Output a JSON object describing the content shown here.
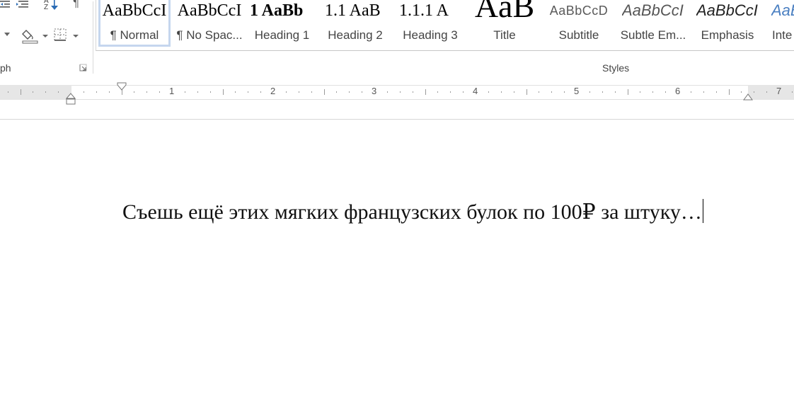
{
  "ribbon": {
    "paragraph_group_label": "ph",
    "styles_group_label": "Styles",
    "pilcrow": "¶",
    "sort_label": "AZ",
    "icons": [
      "decrease-indent-icon",
      "increase-indent-icon",
      "sort-icon",
      "show-formatting-icon",
      "shading-icon",
      "borders-icon",
      "dialog-launcher-icon"
    ]
  },
  "styles": [
    {
      "preview": "AaBbCcI",
      "name": "¶ Normal",
      "selected": true
    },
    {
      "preview": "AaBbCcI",
      "name": "¶ No Spac..."
    },
    {
      "preview": "1 AaBb",
      "name": "Heading 1"
    },
    {
      "preview": "1.1 AaB",
      "name": "Heading 2"
    },
    {
      "preview": "1.1.1 A",
      "name": "Heading 3"
    },
    {
      "preview": "AaB",
      "name": "Title"
    },
    {
      "preview": "AaBbCcD",
      "name": "Subtitle"
    },
    {
      "preview": "AaBbCcI",
      "name": "Subtle Em..."
    },
    {
      "preview": "AaBbCcI",
      "name": "Emphasis"
    },
    {
      "preview": "AaB",
      "name": "Inte"
    }
  ],
  "ruler": {
    "numbers": [
      "1",
      "2",
      "3",
      "4",
      "5",
      "6",
      "7"
    ]
  },
  "document": {
    "text": "Съешь ещё этих мягких французских булок по 100₽ за штуку…"
  },
  "colors": {
    "selected_border": "#c5d6ee",
    "intense_blue": "#4a7fc1"
  }
}
